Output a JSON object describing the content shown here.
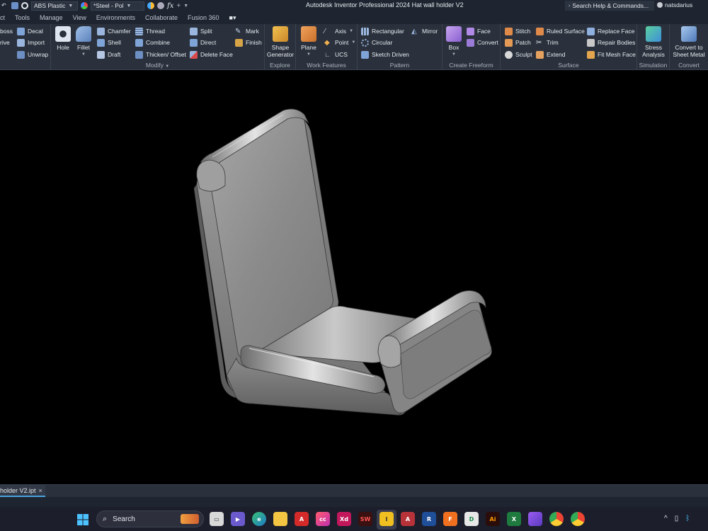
{
  "titlebar": {
    "material": "ABS Plastic",
    "appearance": "*Steel - Pol",
    "app_title": "Autodesk Inventor Professional 2024   Hat wall holder V2",
    "search_placeholder": "Search Help & Commands...",
    "user": "natsdarius"
  },
  "menu_tabs": [
    "ct",
    "Tools",
    "Manage",
    "View",
    "Environments",
    "Collaborate",
    "Fusion 360"
  ],
  "ribbon": {
    "create_partial": [
      "boss",
      "rive"
    ],
    "create_right": [
      "Decal",
      "Import",
      "Unwrap"
    ],
    "modify": {
      "label": "Modify",
      "big": [
        "Hole",
        "Fillet"
      ],
      "col1": [
        "Chamfer",
        "Shell",
        "Draft"
      ],
      "col2": [
        "Thread",
        "Combine",
        "Thicken/ Offset"
      ],
      "col3": [
        "Split",
        "Direct",
        "Delete Face"
      ],
      "col4": [
        "Mark",
        "Finish"
      ]
    },
    "explore": {
      "label": "Explore",
      "big": "Shape Generator"
    },
    "work_features": {
      "label": "Work Features",
      "big": "Plane",
      "items": [
        "Axis",
        "Point",
        "UCS"
      ]
    },
    "pattern": {
      "label": "Pattern",
      "items": [
        "Rectangular",
        "Circular",
        "Sketch Driven"
      ],
      "mirror": "Mirror"
    },
    "create_freeform": {
      "label": "Create Freeform",
      "big": "Box",
      "items": [
        "Face",
        "Convert"
      ]
    },
    "surface": {
      "label": "Surface",
      "col1": [
        "Stitch",
        "Patch",
        "Sculpt"
      ],
      "col2": [
        "Ruled Surface",
        "Trim",
        "Extend"
      ],
      "col3": [
        "Replace Face",
        "Repair Bodies",
        "Fit Mesh Face"
      ]
    },
    "simulation": {
      "label": "Simulation",
      "big": "Stress Analysis"
    },
    "convert": {
      "label": "Convert",
      "big": "Convert to Sheet Metal"
    }
  },
  "document_tab": {
    "label": "holder V2.ipt",
    "close": "×"
  },
  "taskbar": {
    "search_label": "Search",
    "apps": [
      "file-explorer",
      "teams",
      "edge",
      "folder",
      "acrobat",
      "creative-cloud",
      "xd",
      "solidworks",
      "inventor",
      "access",
      "revit",
      "fusion",
      "illustrator-alt",
      "illustrator",
      "excel",
      "outlook",
      "chrome",
      "chrome-alt"
    ]
  },
  "accent_colors": {
    "ribbon_bg": "#2a313c",
    "title_bg": "#1e2530",
    "tab_underline": "#4aa3df"
  }
}
